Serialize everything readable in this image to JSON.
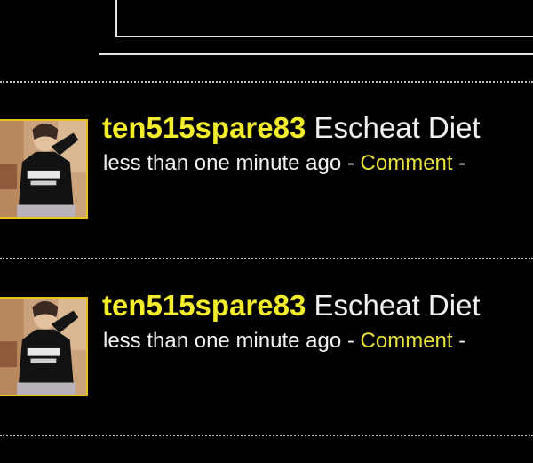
{
  "theme": {
    "background": "#000000",
    "username_color": "#f2ec2a",
    "link_color": "#e7e23a",
    "text_color": "#f0f0f0",
    "avatar_border": "#e8c21a"
  },
  "entries": [
    {
      "username": "ten515spare83",
      "title": "Escheat Diet",
      "timestamp": "less than one minute ago",
      "separator": "-",
      "comment_label": "Comment",
      "trailing": "-"
    },
    {
      "username": "ten515spare83",
      "title": "Escheat Diet",
      "timestamp": "less than one minute ago",
      "separator": "-",
      "comment_label": "Comment",
      "trailing": "-"
    }
  ],
  "icons": {
    "avatar": "user-photo-avatar"
  }
}
